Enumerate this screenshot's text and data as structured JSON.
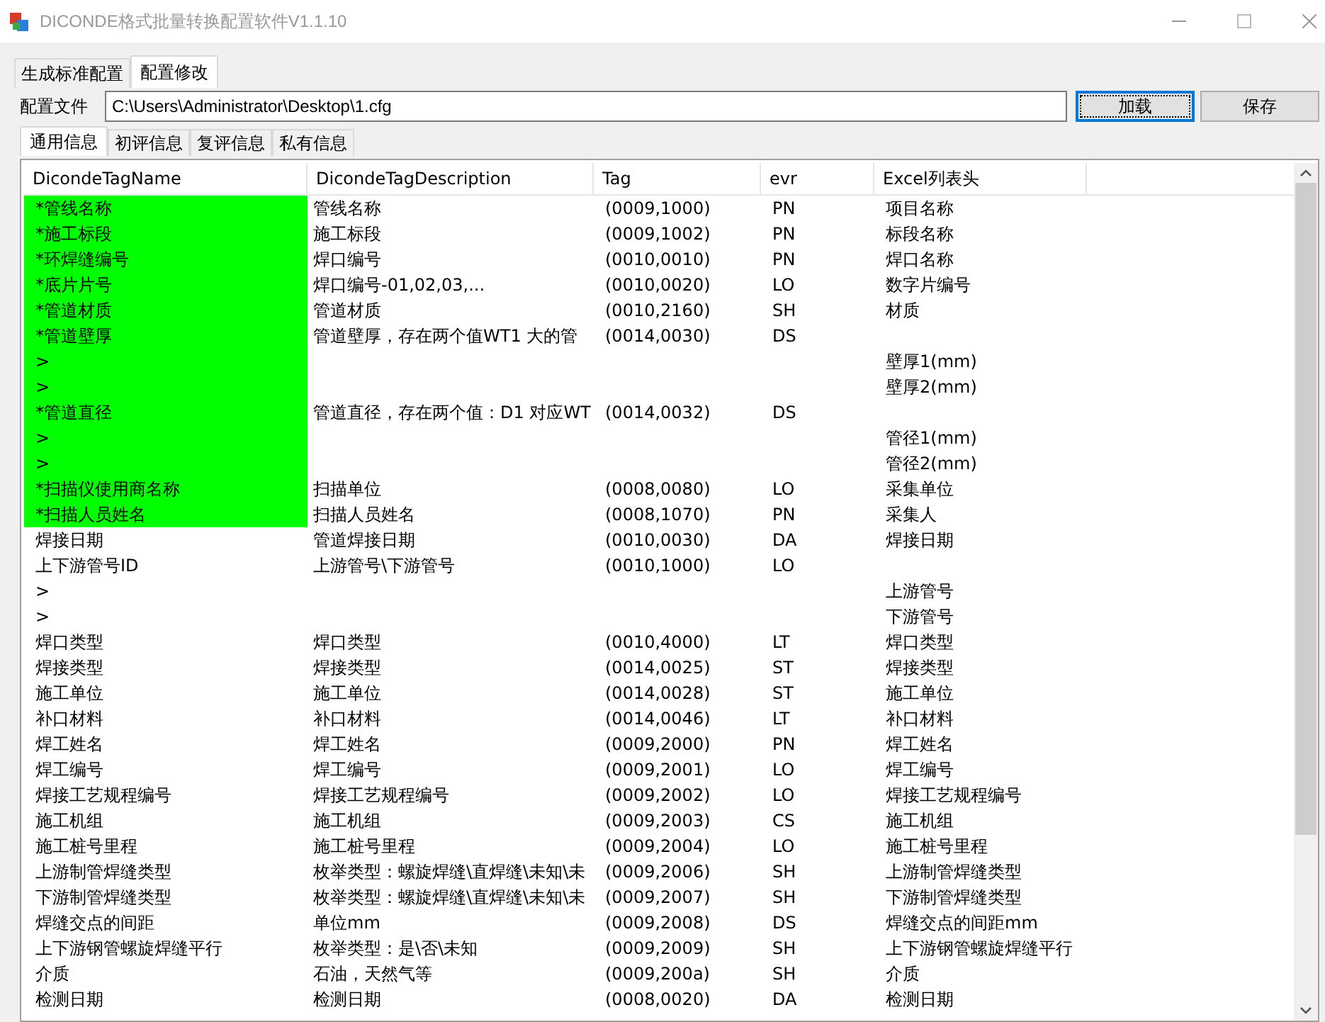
{
  "window": {
    "title": "DICONDE格式批量转换配置软件V1.1.10"
  },
  "tabs": [
    {
      "label": "生成标准配置",
      "selected": false
    },
    {
      "label": "配置修改",
      "selected": true
    }
  ],
  "config_file": {
    "label": "配置文件",
    "value": "C:\\Users\\Administrator\\Desktop\\1.cfg"
  },
  "buttons": [
    {
      "label": "加载",
      "focused": true
    },
    {
      "label": "保存",
      "focused": false
    }
  ],
  "sub_tabs": [
    {
      "label": "通用信息",
      "selected": true
    },
    {
      "label": "初评信息",
      "selected": false
    },
    {
      "label": "复评信息",
      "selected": false
    },
    {
      "label": "私有信息",
      "selected": false
    }
  ],
  "table": {
    "columns": [
      "DicondeTagName",
      "DicondeTagDescription",
      "Tag",
      "evr",
      "Excel列表头"
    ],
    "rows": [
      {
        "required": true,
        "cells": [
          "*管线名称",
          "管线名称",
          "(0009,1000)",
          "PN",
          "项目名称"
        ]
      },
      {
        "required": true,
        "cells": [
          "*施工标段",
          "施工标段",
          "(0009,1002)",
          "PN",
          "标段名称"
        ]
      },
      {
        "required": true,
        "cells": [
          "*环焊缝编号",
          "焊口编号",
          "(0010,0010)",
          "PN",
          "焊口名称"
        ]
      },
      {
        "required": true,
        "cells": [
          "*底片片号",
          "焊口编号-01,02,03,...",
          "(0010,0020)",
          "LO",
          "数字片编号"
        ]
      },
      {
        "required": true,
        "cells": [
          "*管道材质",
          "管道材质",
          "(0010,2160)",
          "SH",
          "材质"
        ]
      },
      {
        "required": true,
        "cells": [
          "*管道壁厚",
          "管道壁厚，存在两个值WT1 大的管",
          "(0014,0030)",
          "DS",
          ""
        ]
      },
      {
        "required": true,
        "cells": [
          ">",
          "",
          "",
          "",
          "壁厚1(mm)"
        ]
      },
      {
        "required": true,
        "cells": [
          ">",
          "",
          "",
          "",
          "壁厚2(mm)"
        ]
      },
      {
        "required": true,
        "cells": [
          "*管道直径",
          "管道直径，存在两个值：D1 对应WT",
          "(0014,0032)",
          "DS",
          ""
        ]
      },
      {
        "required": true,
        "cells": [
          ">",
          "",
          "",
          "",
          "管径1(mm)"
        ]
      },
      {
        "required": true,
        "cells": [
          ">",
          "",
          "",
          "",
          "管径2(mm)"
        ]
      },
      {
        "required": true,
        "cells": [
          "*扫描仪使用商名称",
          "扫描单位",
          "(0008,0080)",
          "LO",
          "采集单位"
        ]
      },
      {
        "required": true,
        "cells": [
          "*扫描人员姓名",
          "扫描人员姓名",
          "(0008,1070)",
          "PN",
          "采集人"
        ]
      },
      {
        "required": false,
        "cells": [
          "焊接日期",
          "管道焊接日期",
          "(0010,0030)",
          "DA",
          "焊接日期"
        ]
      },
      {
        "required": false,
        "cells": [
          "上下游管号ID",
          "上游管号\\下游管号",
          "(0010,1000)",
          "LO",
          ""
        ]
      },
      {
        "required": false,
        "cells": [
          ">",
          "",
          "",
          "",
          "上游管号"
        ]
      },
      {
        "required": false,
        "cells": [
          ">",
          "",
          "",
          "",
          "下游管号"
        ]
      },
      {
        "required": false,
        "cells": [
          "焊口类型",
          "焊口类型",
          "(0010,4000)",
          "LT",
          "焊口类型"
        ]
      },
      {
        "required": false,
        "cells": [
          "焊接类型",
          "焊接类型",
          "(0014,0025)",
          "ST",
          "焊接类型"
        ]
      },
      {
        "required": false,
        "cells": [
          "施工单位",
          "施工单位",
          "(0014,0028)",
          "ST",
          "施工单位"
        ]
      },
      {
        "required": false,
        "cells": [
          "补口材料",
          "补口材料",
          "(0014,0046)",
          "LT",
          "补口材料"
        ]
      },
      {
        "required": false,
        "cells": [
          "焊工姓名",
          "焊工姓名",
          "(0009,2000)",
          "PN",
          "焊工姓名"
        ]
      },
      {
        "required": false,
        "cells": [
          "焊工编号",
          "焊工编号",
          "(0009,2001)",
          "LO",
          "焊工编号"
        ]
      },
      {
        "required": false,
        "cells": [
          "焊接工艺规程编号",
          "焊接工艺规程编号",
          "(0009,2002)",
          "LO",
          "焊接工艺规程编号"
        ]
      },
      {
        "required": false,
        "cells": [
          "施工机组",
          "施工机组",
          "(0009,2003)",
          "CS",
          "施工机组"
        ]
      },
      {
        "required": false,
        "cells": [
          "施工桩号里程",
          "施工桩号里程",
          "(0009,2004)",
          "LO",
          "施工桩号里程"
        ]
      },
      {
        "required": false,
        "cells": [
          "上游制管焊缝类型",
          "枚举类型：螺旋焊缝\\直焊缝\\未知\\未",
          "(0009,2006)",
          "SH",
          "上游制管焊缝类型"
        ]
      },
      {
        "required": false,
        "cells": [
          "下游制管焊缝类型",
          "枚举类型：螺旋焊缝\\直焊缝\\未知\\未",
          "(0009,2007)",
          "SH",
          "下游制管焊缝类型"
        ]
      },
      {
        "required": false,
        "cells": [
          "焊缝交点的间距",
          "单位mm",
          "(0009,2008)",
          "DS",
          "焊缝交点的间距mm"
        ]
      },
      {
        "required": false,
        "cells": [
          "上下游钢管螺旋焊缝平行",
          "枚举类型：是\\否\\未知",
          "(0009,2009)",
          "SH",
          "上下游钢管螺旋焊缝平行"
        ]
      },
      {
        "required": false,
        "cells": [
          "介质",
          "石油，天然气等",
          "(0009,200a)",
          "SH",
          "介质"
        ]
      },
      {
        "required": false,
        "cells": [
          "检测日期",
          "检测日期",
          "(0008,0020)",
          "DA",
          "检测日期"
        ]
      }
    ]
  }
}
